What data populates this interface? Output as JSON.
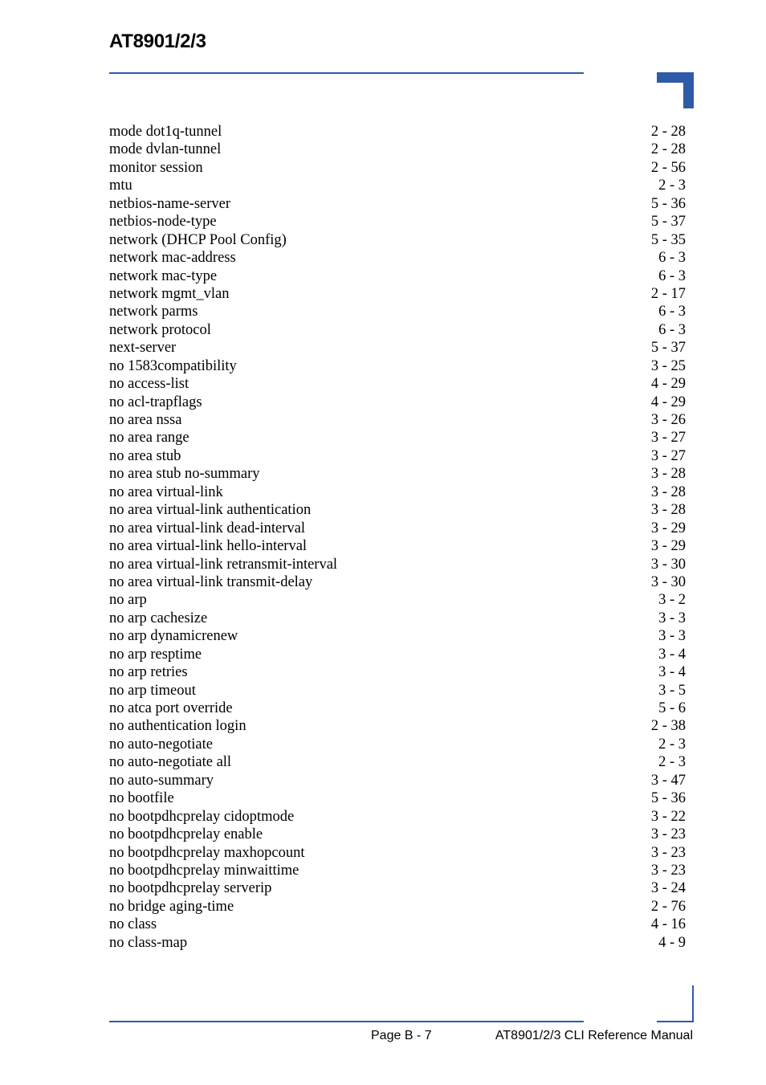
{
  "header": {
    "title": "AT8901/2/3"
  },
  "index_entries": [
    {
      "term": "mode dot1q-tunnel",
      "page": "2 - 28"
    },
    {
      "term": "mode dvlan-tunnel",
      "page": "2 - 28"
    },
    {
      "term": "monitor session",
      "page": "2 - 56"
    },
    {
      "term": "mtu",
      "page": "2 - 3"
    },
    {
      "term": "netbios-name-server",
      "page": "5 - 36"
    },
    {
      "term": "netbios-node-type",
      "page": "5 - 37"
    },
    {
      "term": "network (DHCP Pool Config)",
      "page": "5 - 35"
    },
    {
      "term": "network mac-address",
      "page": "6 - 3"
    },
    {
      "term": "network mac-type",
      "page": "6 - 3"
    },
    {
      "term": "network mgmt_vlan",
      "page": "2 - 17"
    },
    {
      "term": "network parms",
      "page": "6 - 3"
    },
    {
      "term": "network protocol",
      "page": "6 - 3"
    },
    {
      "term": "next-server",
      "page": "5 - 37"
    },
    {
      "term": "no 1583compatibility",
      "page": "3 - 25"
    },
    {
      "term": "no access-list",
      "page": "4 - 29"
    },
    {
      "term": "no acl-trapflags",
      "page": "4 - 29"
    },
    {
      "term": "no area nssa",
      "page": "3 - 26"
    },
    {
      "term": "no area range",
      "page": "3 - 27"
    },
    {
      "term": "no area stub",
      "page": "3 - 27"
    },
    {
      "term": "no area stub no-summary",
      "page": "3 - 28"
    },
    {
      "term": "no area virtual-link",
      "page": "3 - 28"
    },
    {
      "term": "no area virtual-link authentication",
      "page": "3 - 28"
    },
    {
      "term": "no area virtual-link dead-interval",
      "page": "3 - 29"
    },
    {
      "term": "no area virtual-link hello-interval",
      "page": "3 - 29"
    },
    {
      "term": "no area virtual-link retransmit-interval",
      "page": "3 - 30"
    },
    {
      "term": "no area virtual-link transmit-delay",
      "page": "3 - 30"
    },
    {
      "term": "no arp",
      "page": "3 - 2"
    },
    {
      "term": "no arp cachesize",
      "page": "3 - 3"
    },
    {
      "term": "no arp dynamicrenew",
      "page": "3 - 3"
    },
    {
      "term": "no arp resptime",
      "page": "3 - 4"
    },
    {
      "term": "no arp retries",
      "page": "3 - 4"
    },
    {
      "term": "no arp timeout",
      "page": "3 - 5"
    },
    {
      "term": "no atca port override",
      "page": "5 - 6"
    },
    {
      "term": "no authentication login",
      "page": "2 - 38"
    },
    {
      "term": "no auto-negotiate",
      "page": "2 - 3"
    },
    {
      "term": "no auto-negotiate all",
      "page": "2 - 3"
    },
    {
      "term": "no auto-summary",
      "page": "3 - 47"
    },
    {
      "term": "no bootfile",
      "page": "5 - 36"
    },
    {
      "term": "no bootpdhcprelay cidoptmode",
      "page": "3 - 22"
    },
    {
      "term": "no bootpdhcprelay enable",
      "page": "3 - 23"
    },
    {
      "term": "no bootpdhcprelay maxhopcount",
      "page": "3 - 23"
    },
    {
      "term": "no bootpdhcprelay minwaittime",
      "page": "3 - 23"
    },
    {
      "term": "no bootpdhcprelay serverip",
      "page": "3 - 24"
    },
    {
      "term": "no bridge aging-time",
      "page": "2 - 76"
    },
    {
      "term": "no class",
      "page": "4 - 16"
    },
    {
      "term": "no class-map",
      "page": "4 - 9"
    }
  ],
  "footer": {
    "page_label": "Page B - 7",
    "manual_title": "AT8901/2/3 CLI Reference Manual"
  },
  "colors": {
    "accent": "#2f5aa8"
  }
}
